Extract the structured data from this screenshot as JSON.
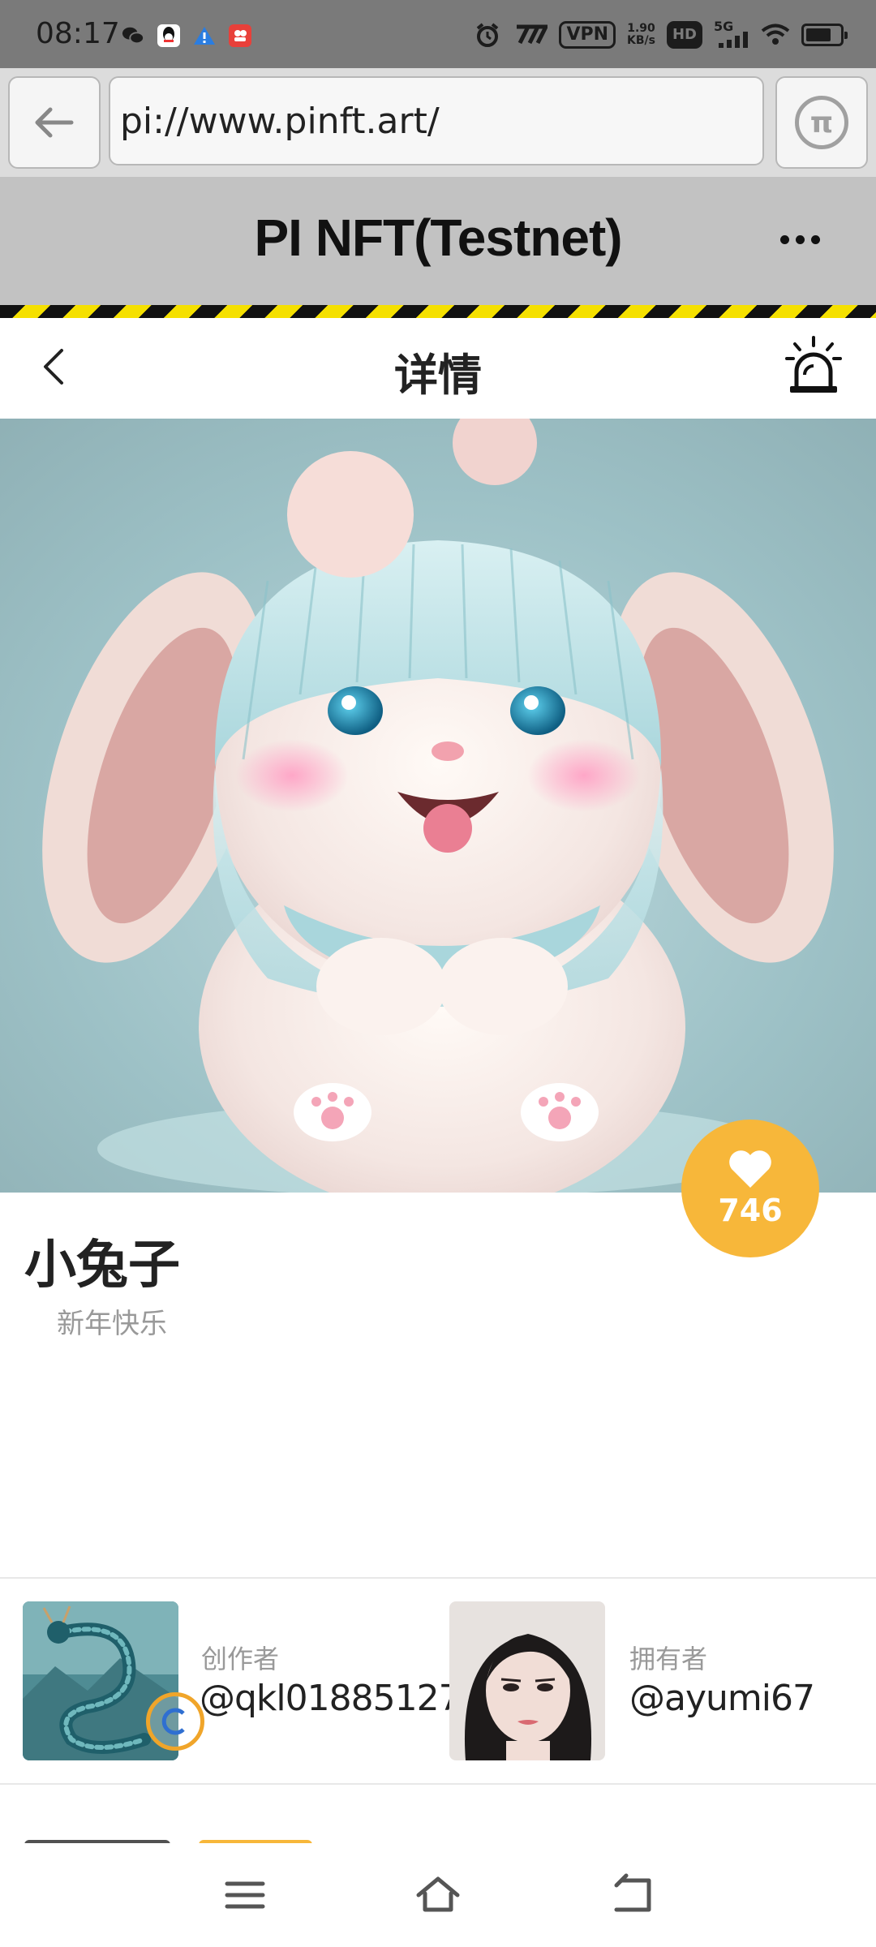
{
  "status_bar": {
    "time": "08:17",
    "vpn": "VPN",
    "speed_value": "1.90",
    "speed_unit": "KB/s",
    "hd": "HD",
    "network": "5G"
  },
  "browser": {
    "url": "pi://www.pinft.art/"
  },
  "app": {
    "title": "PI NFT(Testnet)"
  },
  "page": {
    "title": "详情"
  },
  "nft": {
    "title": "小兔子",
    "description": "新年快乐",
    "likes": "746"
  },
  "creator": {
    "label": "创作者",
    "handle": "@qkl01885127"
  },
  "owner": {
    "label": "拥有者",
    "handle": "@ayumi67"
  },
  "colors": {
    "accent": "#f7b73a",
    "header_bg": "#c2c2c2",
    "stripe_yellow": "#f5e000"
  }
}
